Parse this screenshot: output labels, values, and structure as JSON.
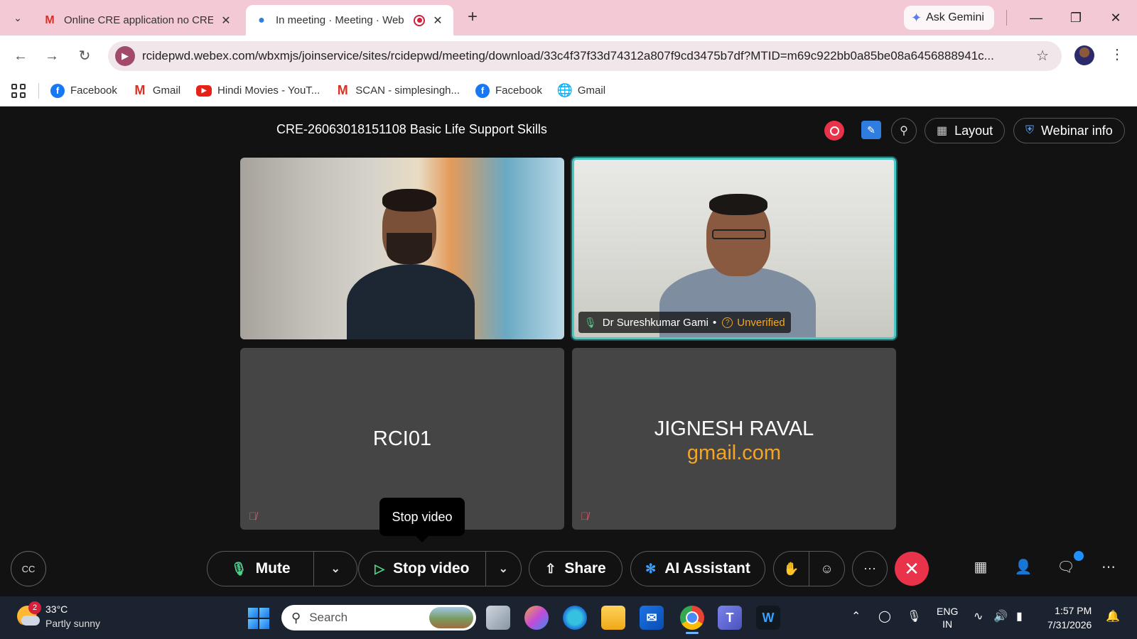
{
  "browser": {
    "tabs": [
      {
        "title": "Online CRE application no CRE",
        "icon": "gmail-icon"
      },
      {
        "title": "In meeting · Meeting · Web",
        "icon": "webex-icon",
        "recording": true
      }
    ],
    "ask_gemini": "Ask Gemini",
    "url": "rcidepwd.webex.com/wbxmjs/joinservice/sites/rcidepwd/meeting/download/33c4f37f33d74312a807f9cd3475b7df?MTID=m69c922bb0a85be08a6456888941c...",
    "bookmarks": [
      {
        "label": "Facebook",
        "icon": "facebook-icon"
      },
      {
        "label": "Gmail",
        "icon": "gmail-icon"
      },
      {
        "label": "Hindi Movies - YouT...",
        "icon": "youtube-icon"
      },
      {
        "label": "SCAN - simplesingh...",
        "icon": "gmail-icon"
      },
      {
        "label": "Facebook",
        "icon": "facebook-icon"
      },
      {
        "label": "Gmail",
        "icon": "globe-icon"
      }
    ]
  },
  "meeting": {
    "title": "CRE-26063018151108 Basic Life Support Skills",
    "layout_label": "Layout",
    "webinar_info_label": "Webinar info",
    "participants": [
      {
        "type": "video"
      },
      {
        "type": "video",
        "name": "Dr Sureshkumar Gami",
        "status": "Unverified",
        "active_speaker": true
      },
      {
        "type": "avatar",
        "name": "RCI01",
        "muted": true
      },
      {
        "type": "avatar",
        "name": "JIGNESH RAVAL",
        "subtitle": "gmail.com",
        "muted": true
      }
    ],
    "tooltip": "Stop video",
    "controls": {
      "mute": "Mute",
      "stop_video": "Stop video",
      "share": "Share",
      "ai_assistant": "AI Assistant"
    },
    "colors": {
      "accent": "#4fc7c2",
      "end_call": "#e9334b",
      "warning": "#f5a524"
    }
  },
  "taskbar": {
    "weather": {
      "temp": "33°C",
      "condition": "Partly sunny",
      "badge": "2"
    },
    "search_placeholder": "Search",
    "lang_line1": "ENG",
    "lang_line2": "IN",
    "time": "1:57 PM",
    "date": "7/31/2026"
  }
}
